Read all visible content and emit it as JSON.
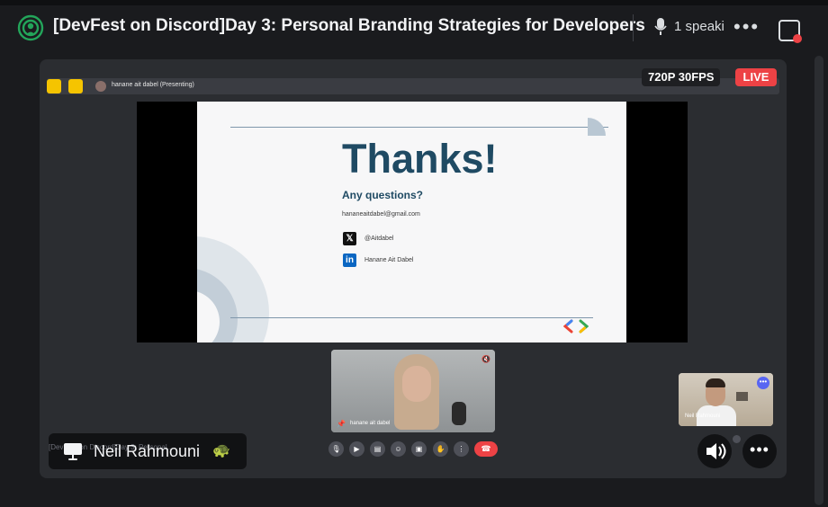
{
  "header": {
    "title": "[DevFest on Discord]Day 3: Personal Branding Strategies for Developers",
    "speakers": "1 speaki",
    "more": "•••"
  },
  "stream": {
    "presenter_label": "hanane ait dabel (Presenting)",
    "quality": "720P 30FPS",
    "live": "LIVE"
  },
  "slide": {
    "title": "Thanks!",
    "subtitle": "Any questions?",
    "email": "hananeaitdabel@gmail.com",
    "x_handle": "@Aitdabel",
    "linkedin": "Hanane Ait Dabel",
    "x_glyph": "𝕏",
    "linkedin_glyph": "in"
  },
  "tiles": {
    "main_name": "hanane ait dabel",
    "small_name": "Neil Rahmouni"
  },
  "footer": {
    "stream_faded": "[DevFest on Discord]Day 3: Personal...",
    "stream_name": "Neil Rahmouni",
    "turtle": "🐢",
    "more": "•••"
  },
  "colors": {
    "accent": "#5865f2",
    "live": "#ed4245",
    "slide_text": "#1f4a63",
    "presenter_tag": "#f5c400"
  }
}
